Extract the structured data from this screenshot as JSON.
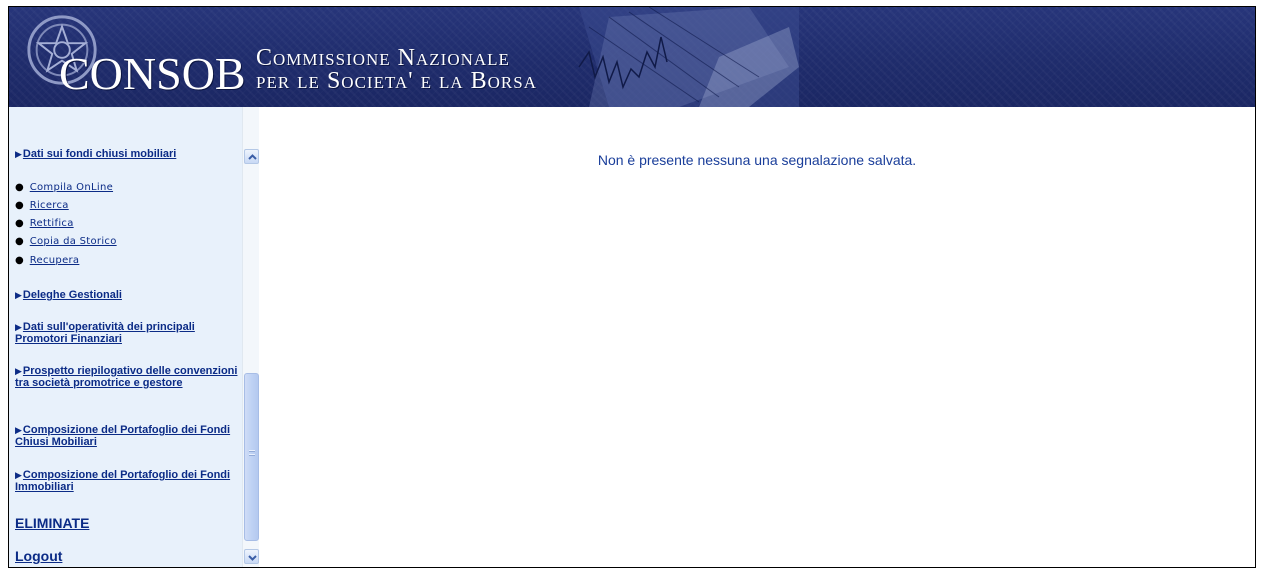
{
  "header": {
    "brand": "CONSOB",
    "subtitle_line1": "Commissione Nazionale",
    "subtitle_line2": "per le Societa' e la Borsa"
  },
  "sidebar": {
    "section_title": "Dati sui fondi chiusi mobiliari",
    "sub_items": [
      {
        "label": "Compila OnLine"
      },
      {
        "label": "Ricerca"
      },
      {
        "label": "Rettifica"
      },
      {
        "label": "Copia da Storico"
      },
      {
        "label": "Recupera"
      }
    ],
    "items": [
      {
        "label": "Deleghe Gestionali"
      },
      {
        "label": "Dati sull'operatività dei principali Promotori Finanziari"
      },
      {
        "label": "Prospetto riepilogativo delle convenzioni tra società promotrice e gestore"
      },
      {
        "label": "Composizione del Portafoglio dei Fondi Chiusi Mobiliari"
      },
      {
        "label": "Composizione del Portafoglio dei Fondi Immobiliari"
      }
    ],
    "eliminate_label": "ELIMINATE",
    "logout_label": "Logout"
  },
  "main": {
    "message": "Non è presente nessuna una segnalazione salvata."
  },
  "colors": {
    "header_bg": "#1f2c6c",
    "sidebar_bg": "#e8f1fb",
    "link": "#0b2b86",
    "message": "#1a3e9a"
  }
}
